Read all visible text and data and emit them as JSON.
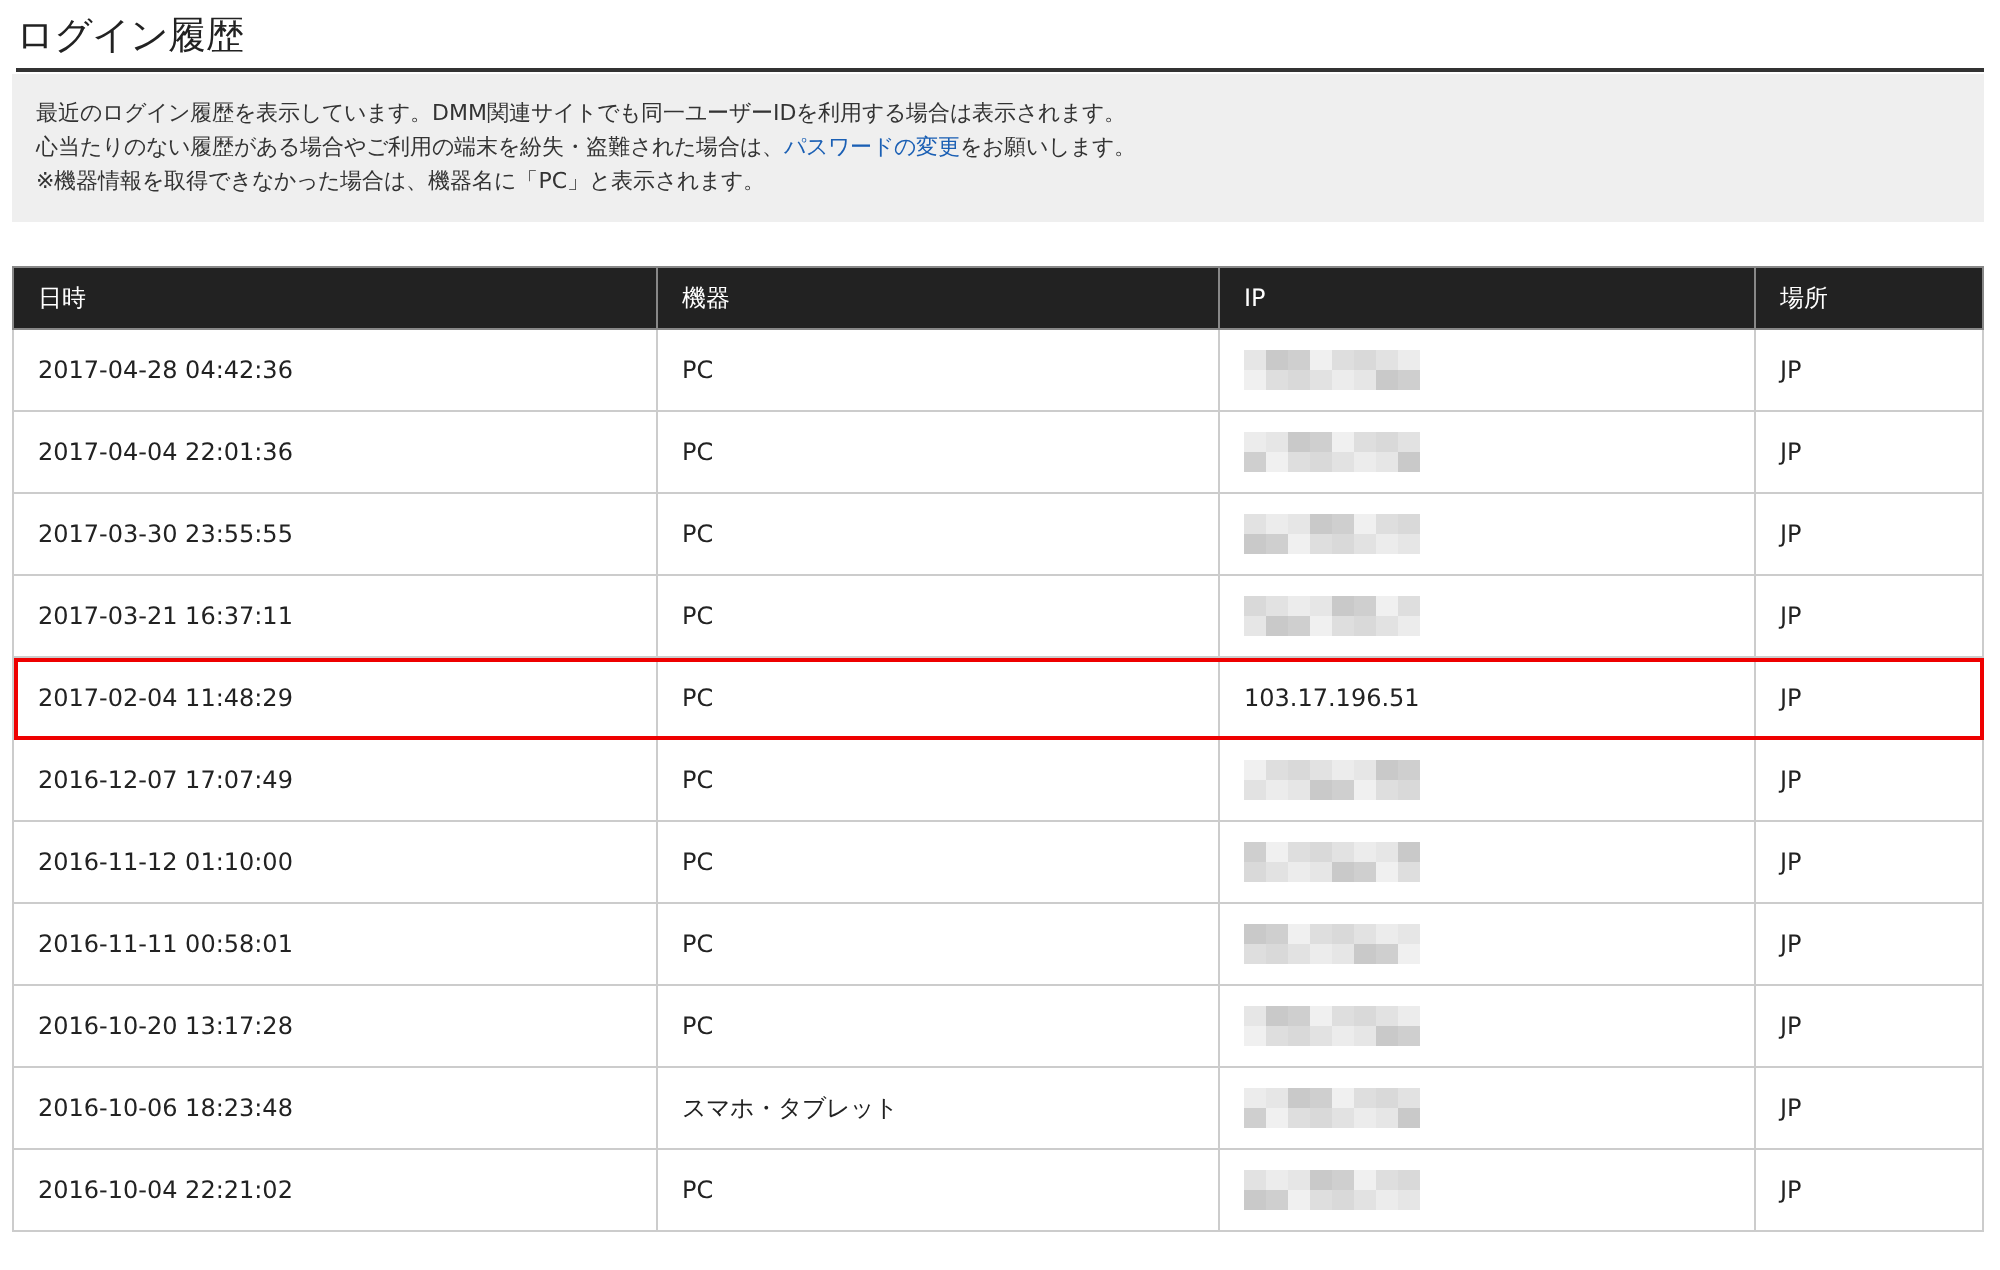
{
  "page": {
    "title": "ログイン履歴"
  },
  "notice": {
    "lines": [
      "最近のログイン履歴を表示しています。DMM関連サイトでも同一ユーザーIDを利用する場合は表示されます。",
      {
        "before": "心当たりのない履歴がある場合やご利用の端末を紛失・盗難された場合は、",
        "link": "パスワードの変更",
        "after": "をお願いします。"
      },
      "※機器情報を取得できなかった場合は、機器名に「PC」と表示されます。"
    ]
  },
  "table": {
    "columns": [
      "日時",
      "機器",
      "IP",
      "場所"
    ],
    "rows": [
      {
        "datetime": "2017-04-28 04:42:36",
        "device": "PC",
        "ip": {
          "kind": "blurred"
        },
        "location": "JP",
        "highlighted": false
      },
      {
        "datetime": "2017-04-04 22:01:36",
        "device": "PC",
        "ip": {
          "kind": "blurred"
        },
        "location": "JP",
        "highlighted": false
      },
      {
        "datetime": "2017-03-30 23:55:55",
        "device": "PC",
        "ip": {
          "kind": "blurred"
        },
        "location": "JP",
        "highlighted": false
      },
      {
        "datetime": "2017-03-21 16:37:11",
        "device": "PC",
        "ip": {
          "kind": "blurred"
        },
        "location": "JP",
        "highlighted": false
      },
      {
        "datetime": "2017-02-04 11:48:29",
        "device": "PC",
        "ip": {
          "kind": "text",
          "text": "103.17.196.51"
        },
        "location": "JP",
        "highlighted": true
      },
      {
        "datetime": "2016-12-07 17:07:49",
        "device": "PC",
        "ip": {
          "kind": "blurred"
        },
        "location": "JP",
        "highlighted": false
      },
      {
        "datetime": "2016-11-12 01:10:00",
        "device": "PC",
        "ip": {
          "kind": "blurred"
        },
        "location": "JP",
        "highlighted": false
      },
      {
        "datetime": "2016-11-11 00:58:01",
        "device": "PC",
        "ip": {
          "kind": "blurred"
        },
        "location": "JP",
        "highlighted": false
      },
      {
        "datetime": "2016-10-20 13:17:28",
        "device": "PC",
        "ip": {
          "kind": "blurred"
        },
        "location": "JP",
        "highlighted": false
      },
      {
        "datetime": "2016-10-06 18:23:48",
        "device": "スマホ・タブレット",
        "ip": {
          "kind": "blurred"
        },
        "location": "JP",
        "highlighted": false
      },
      {
        "datetime": "2016-10-04 22:21:02",
        "device": "PC",
        "ip": {
          "kind": "blurred"
        },
        "location": "JP",
        "highlighted": false
      }
    ]
  }
}
